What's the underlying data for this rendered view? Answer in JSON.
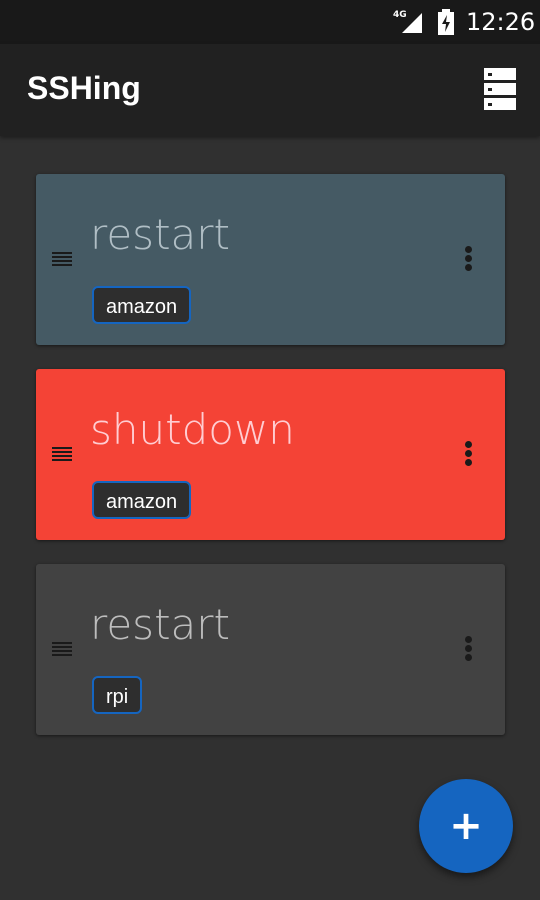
{
  "status_bar": {
    "network_label": "4G",
    "time": "12:26",
    "network_icon": "signal-icon",
    "battery_icon": "battery-charging-icon"
  },
  "app_bar": {
    "title": "SSHing",
    "servers_icon": "servers-icon"
  },
  "commands": [
    {
      "title": "restart",
      "tag": "amazon",
      "card_color": "#455a64",
      "title_color": "#b0bec5"
    },
    {
      "title": "shutdown",
      "tag": "amazon",
      "card_color": "#f44336",
      "title_color": "#ffcdd2"
    },
    {
      "title": "restart",
      "tag": "rpi",
      "card_color": "#424242",
      "title_color": "#bdbdbd"
    }
  ],
  "fab": {
    "label": "+",
    "icon": "add-icon"
  },
  "colors": {
    "accent": "#1565c0",
    "background": "#303030",
    "app_bar": "#212121"
  }
}
